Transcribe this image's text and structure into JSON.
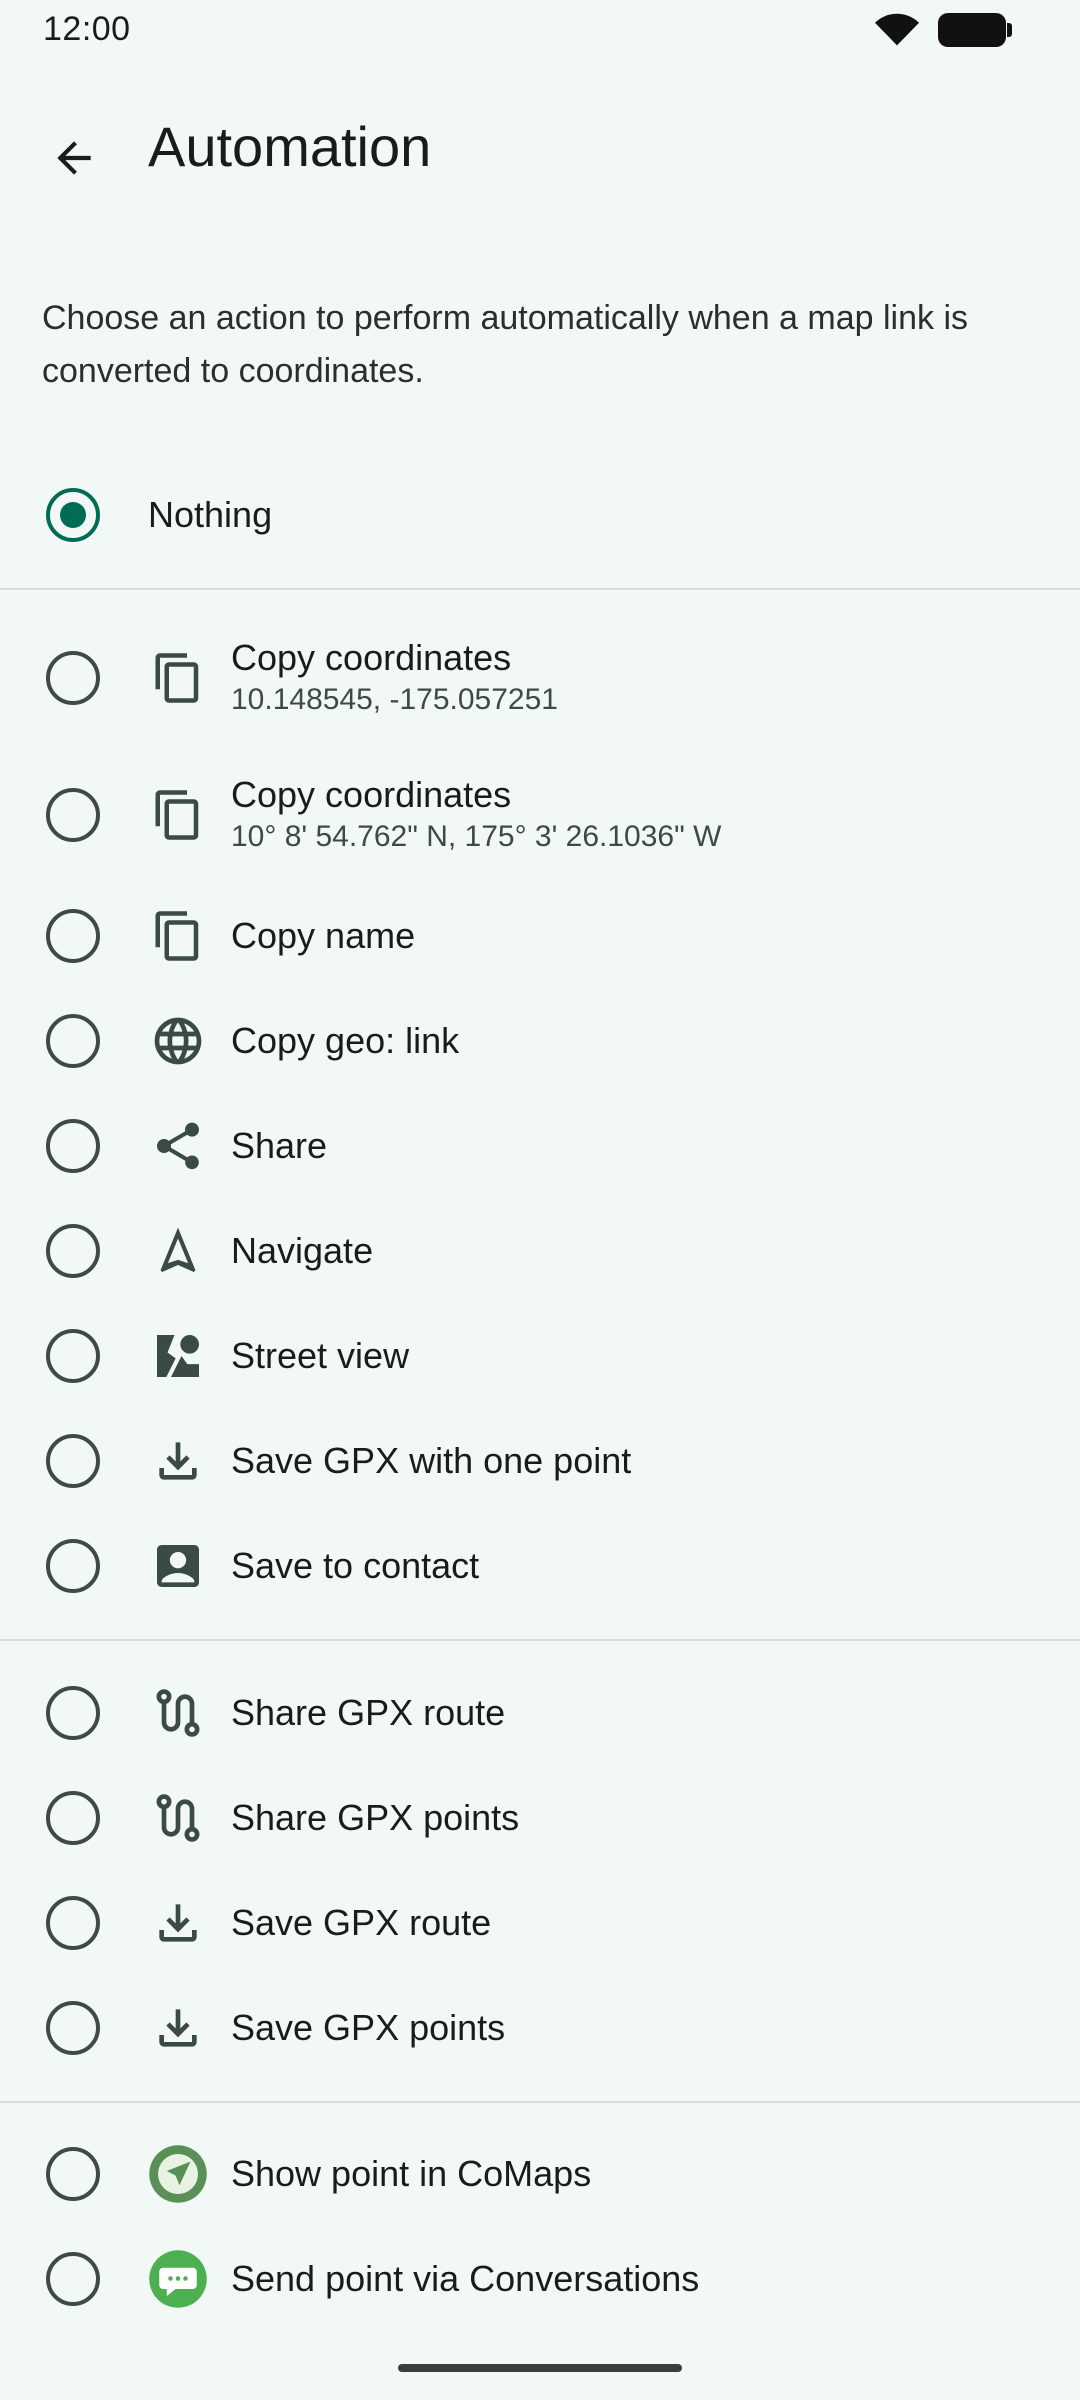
{
  "status_bar": {
    "time": "12:00"
  },
  "header": {
    "title": "Automation"
  },
  "description": "Choose an action to perform automatically when a map link is converted to coordinates.",
  "options": [
    {
      "label": "Nothing",
      "selected": true
    },
    {
      "label": "Copy coordinates",
      "sublabel": "10.148545, -175.057251",
      "icon": "copy-icon"
    },
    {
      "label": "Copy coordinates",
      "sublabel": "10° 8' 54.762\" N, 175° 3' 26.1036\" W",
      "icon": "copy-icon"
    },
    {
      "label": "Copy name",
      "icon": "copy-icon"
    },
    {
      "label": "Copy geo: link",
      "icon": "globe-icon"
    },
    {
      "label": "Share",
      "icon": "share-icon"
    },
    {
      "label": "Navigate",
      "icon": "navigate-icon"
    },
    {
      "label": "Street view",
      "icon": "street-view-icon"
    },
    {
      "label": "Save GPX with one point",
      "icon": "download-icon"
    },
    {
      "label": "Save to contact",
      "icon": "contact-icon"
    },
    {
      "label": "Share GPX route",
      "icon": "route-icon"
    },
    {
      "label": "Share GPX points",
      "icon": "route-icon"
    },
    {
      "label": "Save GPX route",
      "icon": "download-icon"
    },
    {
      "label": "Save GPX points",
      "icon": "download-icon"
    },
    {
      "label": "Show point in CoMaps",
      "icon": "comaps-app-icon"
    },
    {
      "label": "Send point via Conversations",
      "icon": "conversations-app-icon"
    }
  ],
  "colors": {
    "accent": "#006c54",
    "background": "#f1f8f5",
    "icon": "#3a4a44"
  }
}
